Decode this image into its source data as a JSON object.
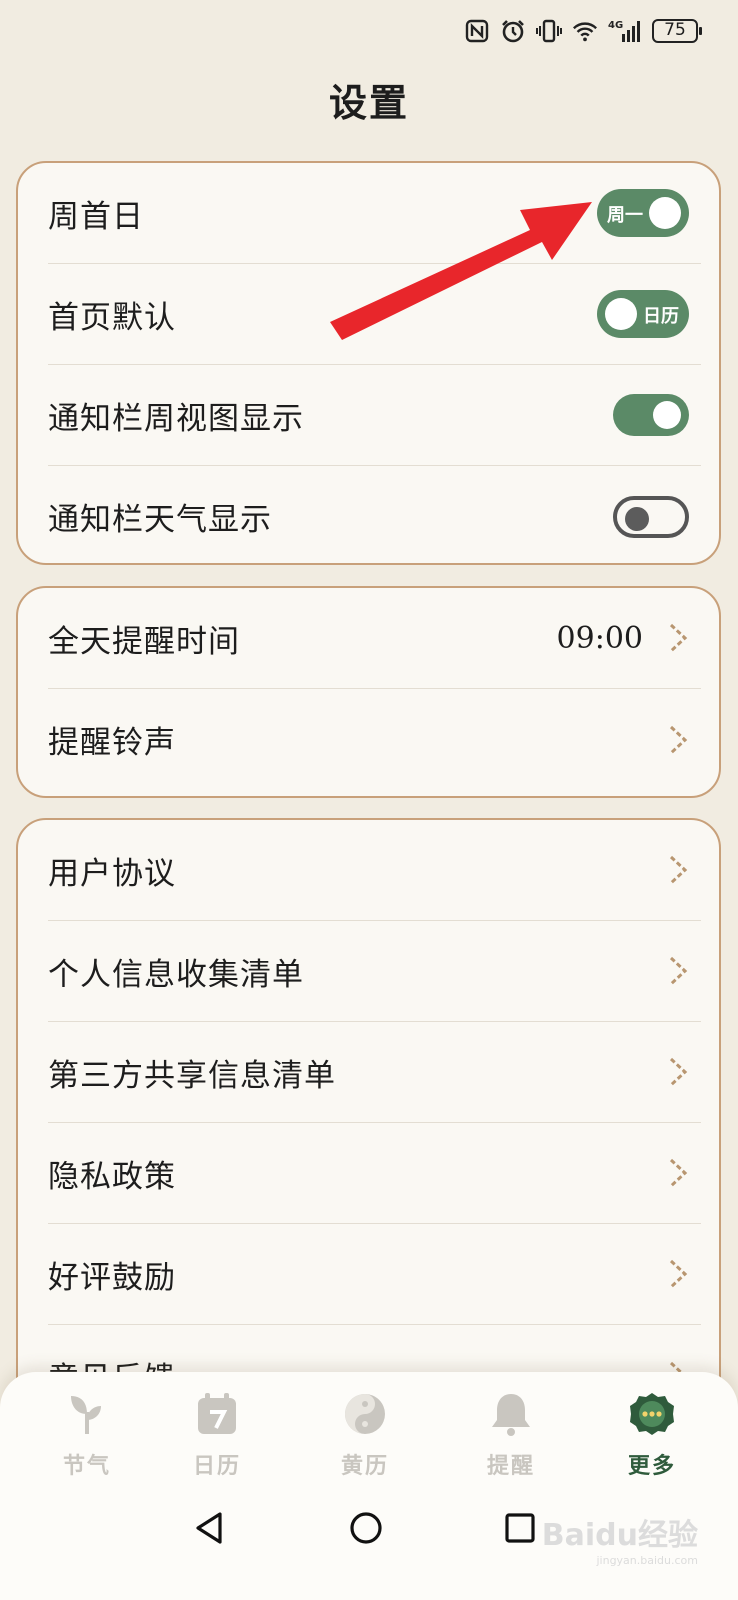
{
  "status_bar": {
    "network_label": "4G",
    "battery": "75",
    "icons": [
      "nfc-icon",
      "alarm-icon",
      "vibrate-icon",
      "wifi-icon",
      "signal-icon",
      "battery-icon"
    ]
  },
  "title": "设置",
  "group1": {
    "rows": [
      {
        "label": "周首日",
        "toggle_text": "周一",
        "state": "on"
      },
      {
        "label": "首页默认",
        "toggle_text": "日历",
        "state": "on"
      },
      {
        "label": "通知栏周视图显示",
        "state": "on"
      },
      {
        "label": "通知栏天气显示",
        "state": "off"
      }
    ]
  },
  "group2": {
    "rows": [
      {
        "label": "全天提醒时间",
        "value": "09:00"
      },
      {
        "label": "提醒铃声"
      }
    ]
  },
  "group3": {
    "rows": [
      {
        "label": "用户协议"
      },
      {
        "label": "个人信息收集清单"
      },
      {
        "label": "第三方共享信息清单"
      },
      {
        "label": "隐私政策"
      },
      {
        "label": "好评鼓励"
      },
      {
        "label": "意见反馈"
      }
    ]
  },
  "bottom_nav": {
    "items": [
      {
        "label": "节气",
        "icon": "sprout-icon",
        "active": false
      },
      {
        "label": "日历",
        "icon": "calendar-icon",
        "active": false
      },
      {
        "label": "黄历",
        "icon": "yin-yang-icon",
        "active": false
      },
      {
        "label": "提醒",
        "icon": "bell-icon",
        "active": false
      },
      {
        "label": "更多",
        "icon": "more-icon",
        "active": true
      }
    ]
  },
  "watermark": {
    "text": "Baidu经验",
    "sub": "jingyan.baidu.com"
  },
  "colors": {
    "accent_green": "#5b8a67",
    "card_border": "#c8a07a",
    "background": "#f1ece1",
    "arrow_red": "#e8262b"
  }
}
